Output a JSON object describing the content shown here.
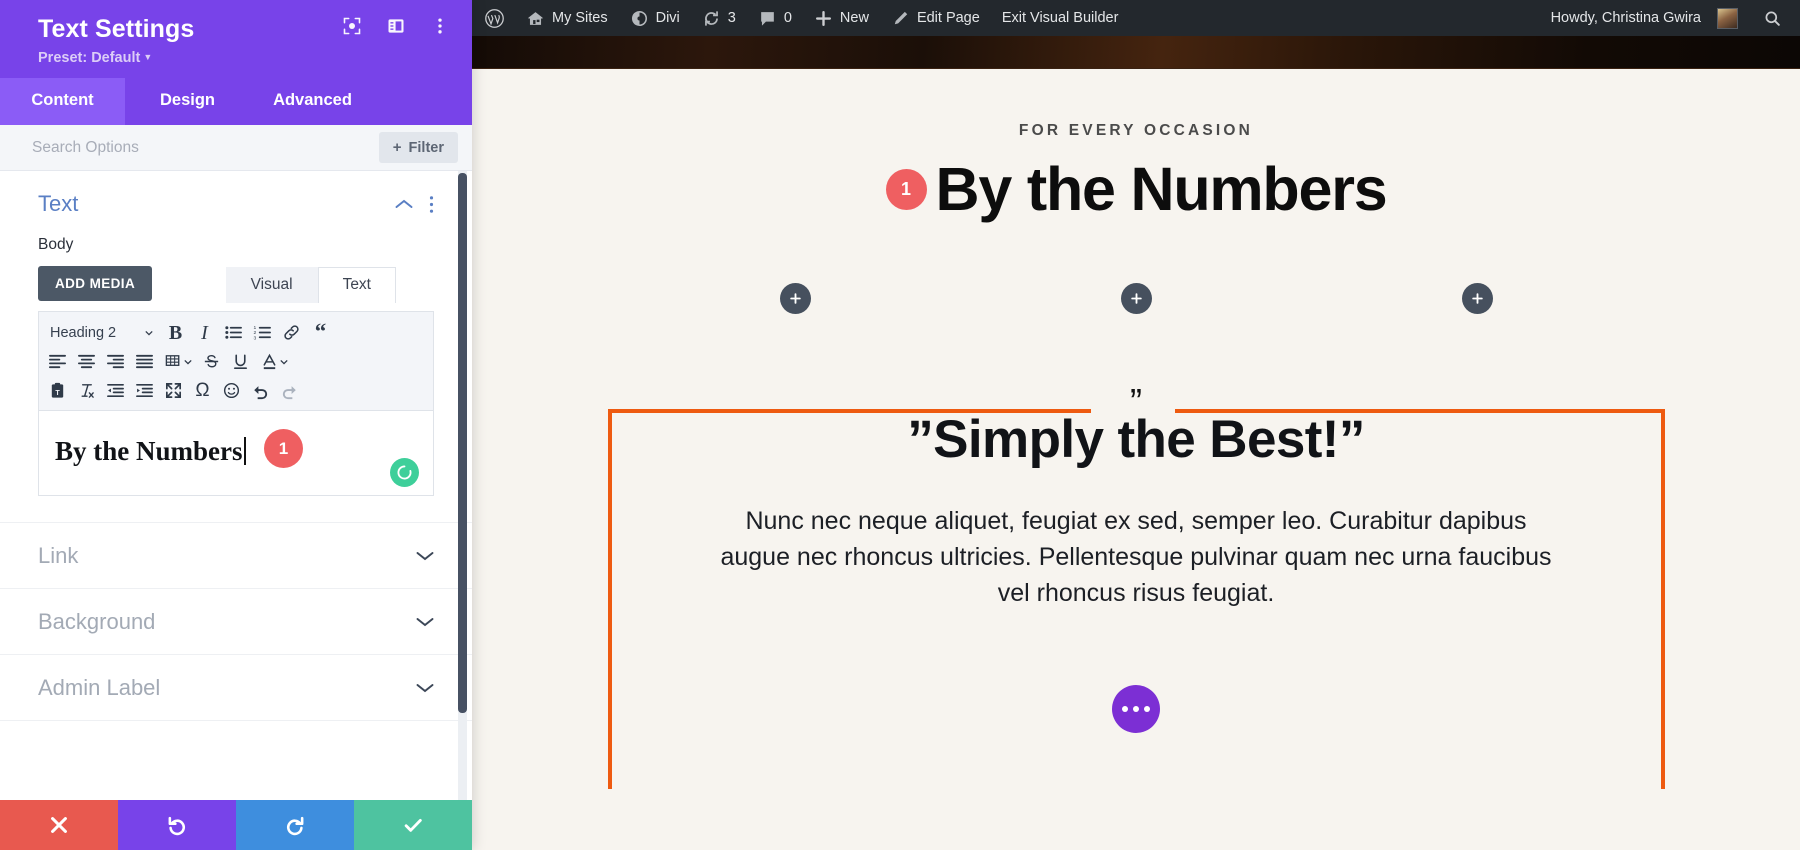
{
  "settings_panel": {
    "title": "Text Settings",
    "preset_label": "Preset: Default",
    "header_icons": [
      {
        "name": "focus-icon"
      },
      {
        "name": "layout-toggle-icon"
      },
      {
        "name": "more-options-icon"
      }
    ],
    "tabs": [
      {
        "label": "Content",
        "active": true
      },
      {
        "label": "Design",
        "active": false
      },
      {
        "label": "Advanced",
        "active": false
      }
    ],
    "search": {
      "value": "",
      "placeholder": "Search Options"
    },
    "filter_button": {
      "label": "Filter",
      "plus": "+"
    },
    "sections": [
      {
        "title": "Text",
        "open": true
      },
      {
        "title": "Link",
        "open": false
      },
      {
        "title": "Background",
        "open": false
      },
      {
        "title": "Admin Label",
        "open": false
      }
    ],
    "text_section": {
      "field_label": "Body",
      "add_media_label": "ADD MEDIA",
      "editor_tabs": [
        {
          "label": "Visual",
          "active": true
        },
        {
          "label": "Text",
          "active": false
        }
      ],
      "format_select": "Heading 2",
      "toolbar_row1": [
        "bold-icon",
        "italic-icon",
        "bulleted-list-icon",
        "numbered-list-icon",
        "link-icon",
        "blockquote-icon"
      ],
      "toolbar_row2": [
        "align-left-icon",
        "align-center-icon",
        "align-right-icon",
        "align-justify-icon",
        "table-icon",
        "strikethrough-icon",
        "underline-icon",
        "text-color-icon"
      ],
      "toolbar_row3": [
        "paste-as-text-icon",
        "clear-formatting-icon",
        "outdent-icon",
        "indent-icon",
        "fullscreen-icon",
        "special-character-icon",
        "emoji-icon",
        "undo-icon",
        "redo-icon"
      ],
      "editor_content": "By the Numbers",
      "editor_badge": "1",
      "spinner_icon": "loading-spinner-icon"
    },
    "footer_buttons": [
      {
        "name": "cancel-button",
        "icon": "close-icon"
      },
      {
        "name": "undo-button",
        "icon": "undo-arrow-icon"
      },
      {
        "name": "redo-button",
        "icon": "redo-arrow-icon"
      },
      {
        "name": "save-button",
        "icon": "checkmark-icon"
      }
    ]
  },
  "admin_bar": {
    "items": [
      {
        "label": "",
        "icon": "wordpress-logo-icon"
      },
      {
        "label": "My Sites",
        "icon": "sites-icon"
      },
      {
        "label": "Divi",
        "icon": "divi-icon"
      },
      {
        "label": "3",
        "icon": "updates-icon"
      },
      {
        "label": "0",
        "icon": "comments-icon"
      },
      {
        "label": "New",
        "icon": "plus-icon"
      },
      {
        "label": "Edit Page",
        "icon": "pencil-icon"
      },
      {
        "label": "Exit Visual Builder",
        "icon": ""
      }
    ],
    "howdy": "Howdy, Christina Gwira",
    "avatar": "user-avatar",
    "search_icon": "search-icon"
  },
  "canvas": {
    "eyebrow": "FOR EVERY OCCASION",
    "heading_badge": "1",
    "heading": "By the Numbers",
    "add_module_buttons": [
      "+",
      "+",
      "+"
    ],
    "quote": {
      "mark": "”",
      "title": "”Simply the Best!”",
      "body": "Nunc nec neque aliquet, feugiat ex sed, semper leo. Curabitur dapibus augue nec rhoncus ultricies. Pellentesque pulvinar quam nec urna faucibus vel rhoncus risus feugiat.",
      "border_color": "#ee5a10"
    },
    "module_actions_icon": "ellipsis-icon"
  },
  "colors": {
    "panel_purple": "#7843e9",
    "tab_active_purple": "#8b5cf6",
    "badge_red": "#ef5f61",
    "quote_orange": "#ee5a10",
    "save_green": "#4ec3a0",
    "cancel_red": "#e8594f",
    "redo_blue": "#3e8ede",
    "canvas_bg": "#f7f4ef",
    "adminbar_bg": "#23282d"
  }
}
